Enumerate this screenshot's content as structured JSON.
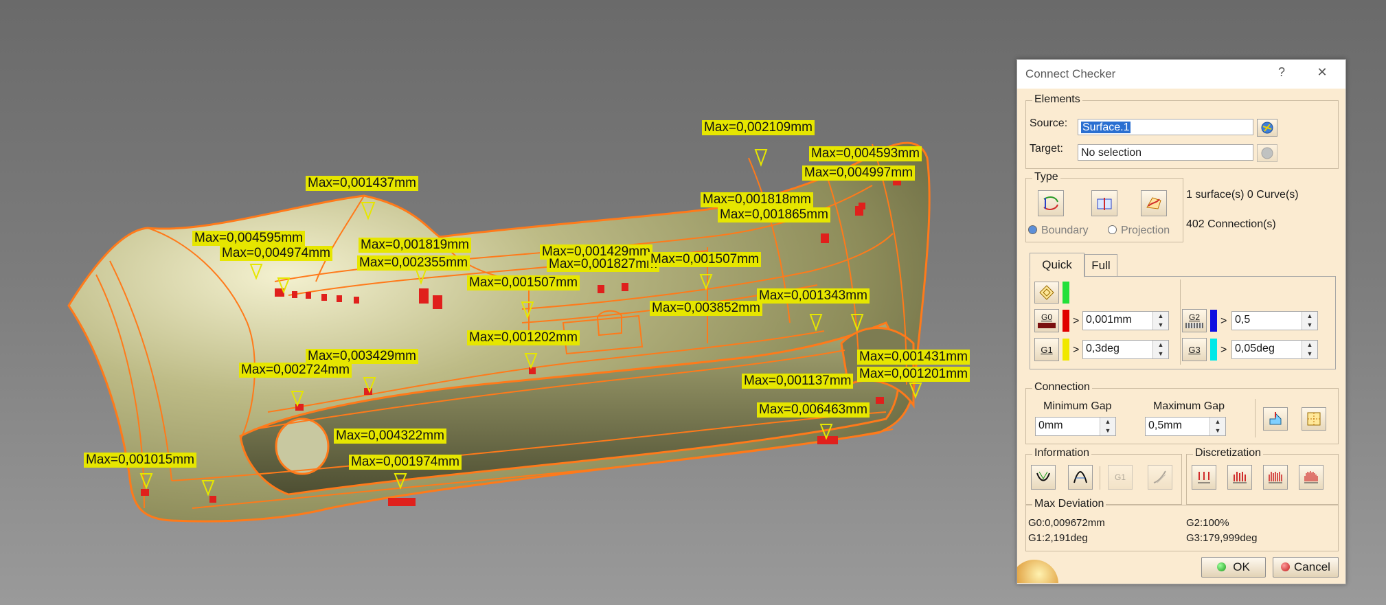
{
  "viewport": {
    "labels": [
      {
        "text": "Max=0,002109mm"
      },
      {
        "text": "Max=0,001437mm"
      },
      {
        "text": "Max=0,004593mm"
      },
      {
        "text": "Max=0,004997mm"
      },
      {
        "text": "Max=0,001818mm"
      },
      {
        "text": "Max=0,001865mm"
      },
      {
        "text": "Max=0,004595mm"
      },
      {
        "text": "Max=0,004974mm"
      },
      {
        "text": "Max=0,001819mm"
      },
      {
        "text": "Max=0,002355mm"
      },
      {
        "text": "Max=0,001429mm"
      },
      {
        "text": "Max=0,001827mm"
      },
      {
        "text": "Max=0,001507mm"
      },
      {
        "text": "Max=0,001507mm"
      },
      {
        "text": "Max=0,001343mm"
      },
      {
        "text": "Max=0,003852mm"
      },
      {
        "text": "Max=0,001202mm"
      },
      {
        "text": "Max=0,003429mm"
      },
      {
        "text": "Max=0,002724mm"
      },
      {
        "text": "Max=0,001431mm"
      },
      {
        "text": "Max=0,001201mm"
      },
      {
        "text": "Max=0,001137mm"
      },
      {
        "text": "Max=0,006463mm"
      },
      {
        "text": "Max=0,004322mm"
      },
      {
        "text": "Max=0,001974mm"
      },
      {
        "text": "Max=0,001015mm"
      }
    ]
  },
  "dialog": {
    "title": "Connect Checker",
    "help": "?",
    "close": "✕",
    "elements": {
      "legend": "Elements",
      "source_label": "Source:",
      "source_value": "Surface.1",
      "target_label": "Target:",
      "target_value": "No selection"
    },
    "type": {
      "legend": "Type",
      "boundary": "Boundary",
      "projection": "Projection",
      "count_line1": "1 surface(s)  0 Curve(s)",
      "count_line2": "402 Connection(s)"
    },
    "tabs": {
      "quick": "Quick",
      "full": "Full"
    },
    "quick": {
      "g0_label": "G0",
      "g0_value": "0,001mm",
      "g1_label": "G1",
      "g1_value": "0,3deg",
      "g2_label": "G2",
      "g2_value": "0,5",
      "g3_label": "G3",
      "g3_value": "0,05deg",
      "gt": ">"
    },
    "connection": {
      "legend": "Connection",
      "min_label": "Minimum Gap",
      "min_value": "0mm",
      "max_label": "Maximum Gap",
      "max_value": "0,5mm"
    },
    "information": {
      "legend": "Information"
    },
    "discretization": {
      "legend": "Discretization"
    },
    "max_deviation": {
      "legend": "Max Deviation",
      "g0": "G0:0,009672mm",
      "g1": "G1:2,191deg",
      "g2": "G2:100%",
      "g3": "G3:179,999deg"
    },
    "ok": "OK",
    "cancel": "Cancel"
  },
  "colors": {
    "label_bg": "#e6e600",
    "curve": "#ff7a1a",
    "defect": "#e0201c",
    "g0": "#e00000",
    "g1": "#f0e800",
    "g2": "#1010e0",
    "g3": "#00e8e8",
    "ok_status": "#22c32a"
  }
}
